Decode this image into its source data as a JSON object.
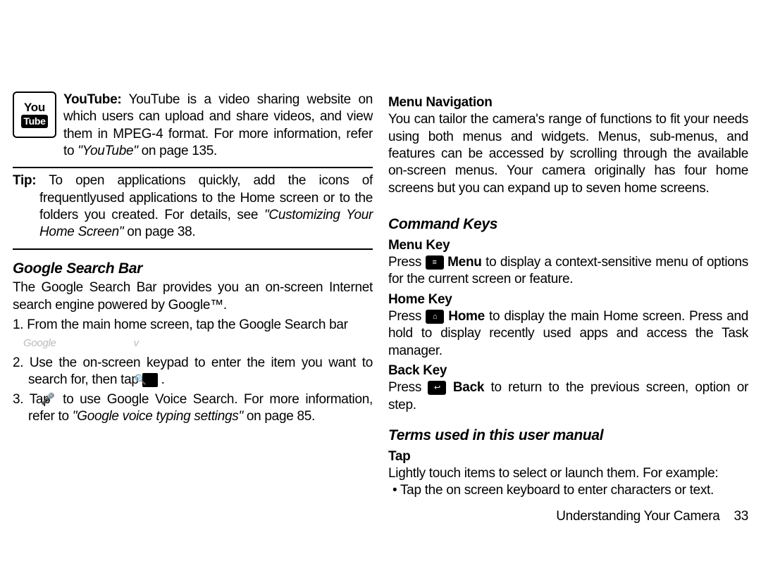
{
  "left": {
    "youtube_icon_top": "You",
    "youtube_icon_bot": "Tube",
    "youtube_label": "YouTube:",
    "youtube_text": " YouTube is a video sharing website on which users can upload and share videos, and view them in MPEG-4 format. For more information, refer to ",
    "youtube_ref": "\"YouTube\"",
    "youtube_ref_tail": " on page 135.",
    "tip_label": "Tip:",
    "tip_text": " To open applications quickly, add the icons of frequentlyused applications to the Home screen or to the folders you created. For details, see ",
    "tip_ref": "\"Customizing Your Home Screen\"",
    "tip_ref_tail": " on page 38.",
    "gsb_head": "Google Search Bar",
    "gsb_text": "The Google Search Bar provides you an on-screen Internet search engine powered by Google™.",
    "gsb_step1": "1. From the main home screen, tap the Google Search bar",
    "gsb_placeholder": "Google",
    "gsb_mic_small": "v",
    "gsb_step2a": "2. Use the on-screen keypad to enter the item you want to search for, then tap ",
    "gsb_step2b": " .",
    "gsb_step3a": "3. Tap ",
    "gsb_step3b": " to use Google Voice Search. For more information, refer to ",
    "gsb_step3_ref": "\"Google voice typing settings\"",
    "gsb_step3_tail": " on page 85."
  },
  "right": {
    "menu_nav_head": "Menu Navigation",
    "menu_nav_text": "You can tailor the camera's range of functions to fit your needs using both menus and widgets. Menus, sub-menus, and features can be accessed by scrolling through the available on-screen menus. Your camera originally has four home screens but you can expand up to seven home screens.",
    "cmd_keys_head": "Command Keys",
    "menu_key_head": "Menu Key",
    "menu_key_a": "Press ",
    "menu_key_b": "Menu",
    "menu_key_c": " to display a context-sensitive menu of options for the current screen or feature.",
    "home_key_head": "Home Key",
    "home_key_a": "Press ",
    "home_key_b": "Home",
    "home_key_c": " to display the main Home screen. Press and hold to display recently used apps and access the Task manager.",
    "back_key_head": "Back Key",
    "back_key_a": "Press ",
    "back_key_b": "Back",
    "back_key_c": " to return to the previous screen, option or step.",
    "terms_head": "Terms used in this user manual",
    "tap_head": "Tap",
    "tap_text": "Lightly touch items to select or launch them. For example:",
    "tap_bullet": "• Tap the on screen keyboard to enter characters or text.",
    "footer_text": "Understanding Your Camera",
    "footer_page": "33"
  },
  "icons": {
    "menu_glyph": "≡",
    "home_glyph": "⌂",
    "back_glyph": "↩",
    "search_glyph": "🔍",
    "mic_glyph": "🎤"
  }
}
